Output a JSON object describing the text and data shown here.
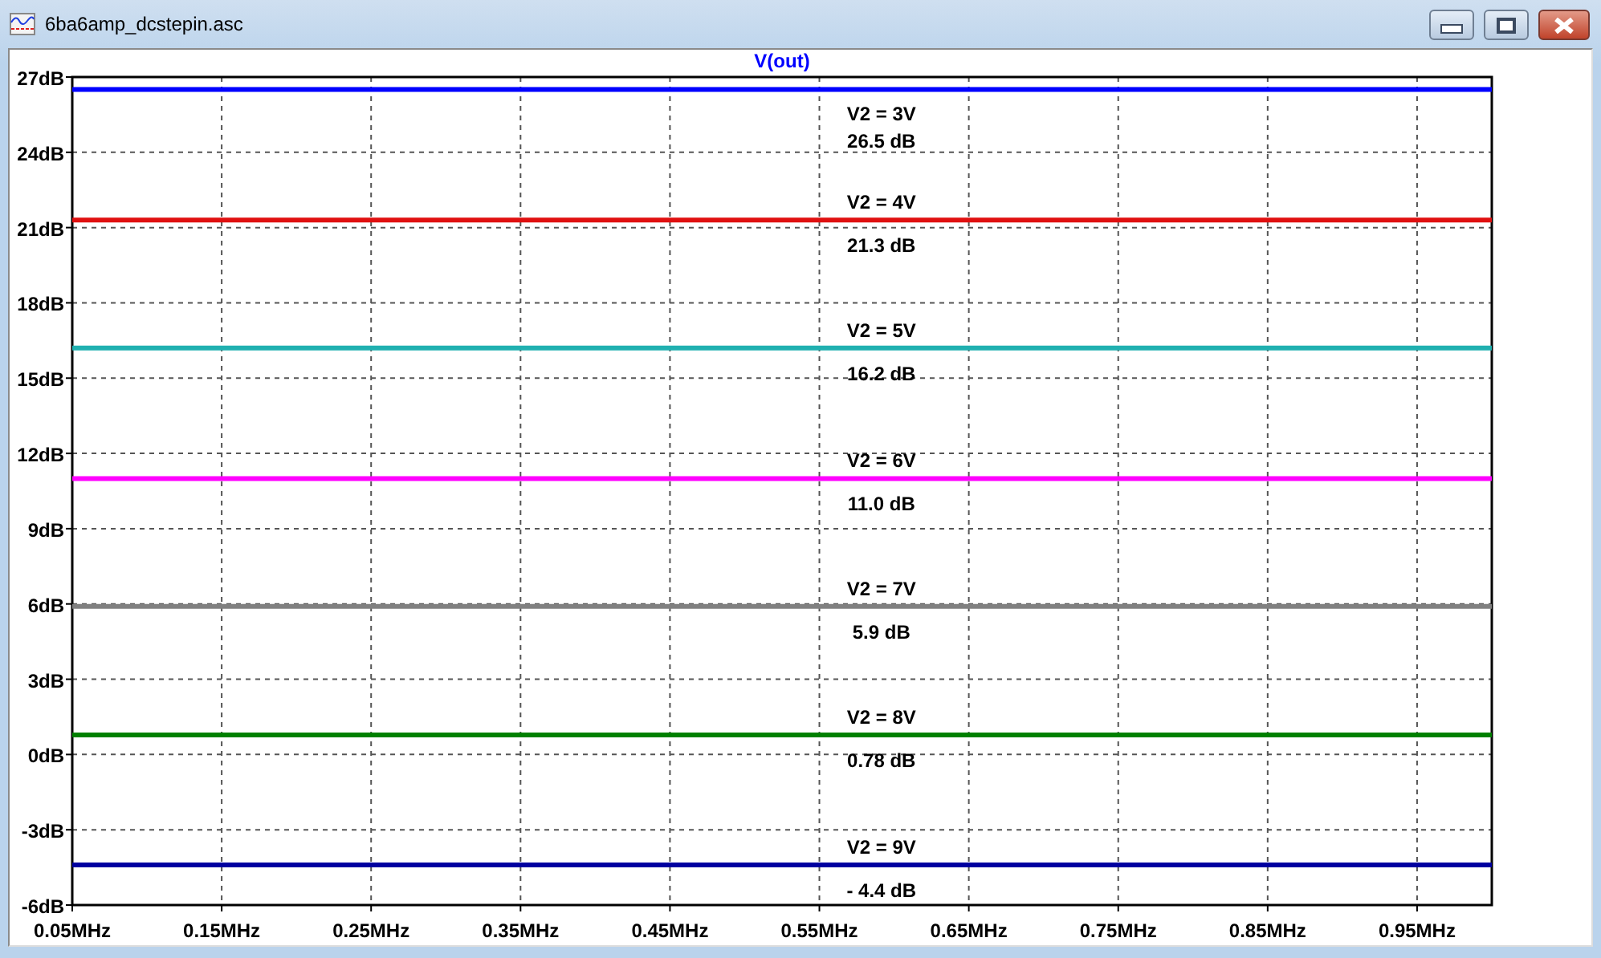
{
  "window": {
    "title": "6ba6amp_dcstepin.asc"
  },
  "plot": {
    "chart_data": {
      "type": "line",
      "title": "V(out)",
      "x": [
        0.05,
        1.0
      ],
      "grid": true,
      "xlim": [
        0.05,
        1.0
      ],
      "ylim": [
        -6,
        27
      ],
      "xticks": [
        {
          "value": 0.05,
          "label": "0.05MHz"
        },
        {
          "value": 0.15,
          "label": "0.15MHz"
        },
        {
          "value": 0.25,
          "label": "0.25MHz"
        },
        {
          "value": 0.35,
          "label": "0.35MHz"
        },
        {
          "value": 0.45,
          "label": "0.45MHz"
        },
        {
          "value": 0.55,
          "label": "0.55MHz"
        },
        {
          "value": 0.65,
          "label": "0.65MHz"
        },
        {
          "value": 0.75,
          "label": "0.75MHz"
        },
        {
          "value": 0.85,
          "label": "0.85MHz"
        },
        {
          "value": 0.95,
          "label": "0.95MHz"
        }
      ],
      "yticks": [
        {
          "value": 27,
          "label": "27dB"
        },
        {
          "value": 24,
          "label": "24dB"
        },
        {
          "value": 21,
          "label": "21dB"
        },
        {
          "value": 18,
          "label": "18dB"
        },
        {
          "value": 15,
          "label": "15dB"
        },
        {
          "value": 12,
          "label": "12dB"
        },
        {
          "value": 9,
          "label": "9dB"
        },
        {
          "value": 6,
          "label": "6dB"
        },
        {
          "value": 3,
          "label": "3dB"
        },
        {
          "value": 0,
          "label": "0dB"
        },
        {
          "value": -3,
          "label": "-3dB"
        },
        {
          "value": -6,
          "label": "-6dB"
        }
      ],
      "series": [
        {
          "name": "V2 = 3V",
          "color": "#0000ff",
          "values": [
            26.5,
            26.5
          ]
        },
        {
          "name": "V2 = 4V",
          "color": "#e01010",
          "values": [
            21.3,
            21.3
          ]
        },
        {
          "name": "V2 = 5V",
          "color": "#20b0b0",
          "values": [
            16.2,
            16.2
          ]
        },
        {
          "name": "V2 = 6V",
          "color": "#ff00ff",
          "values": [
            11.0,
            11.0
          ]
        },
        {
          "name": "V2 = 7V",
          "color": "#808080",
          "values": [
            5.9,
            5.9
          ]
        },
        {
          "name": "V2 = 8V",
          "color": "#008000",
          "values": [
            0.78,
            0.78
          ]
        },
        {
          "name": "V2 = 9V",
          "color": "#0000a0",
          "values": [
            -4.4,
            -4.4
          ]
        }
      ],
      "annotations": [
        {
          "y": 26.5,
          "text": "26.5 dB"
        },
        {
          "y": 21.3,
          "text": "21.3 dB"
        },
        {
          "y": 16.2,
          "text": "16.2 dB"
        },
        {
          "y": 11.0,
          "text": "11.0 dB"
        },
        {
          "y": 5.9,
          "text": "5.9 dB"
        },
        {
          "y": 0.78,
          "text": "0.78 dB"
        },
        {
          "y": -4.4,
          "text": "- 4.4 dB"
        }
      ]
    }
  }
}
